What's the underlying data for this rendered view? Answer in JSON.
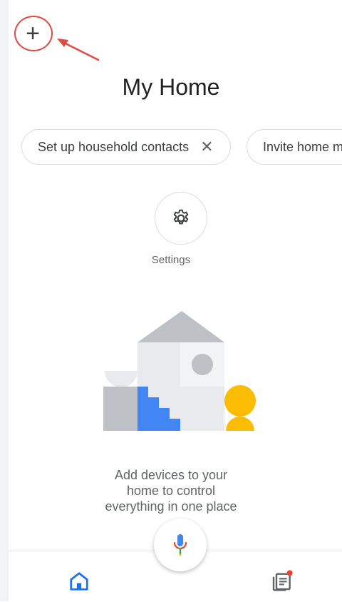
{
  "header": {
    "title": "My Home"
  },
  "chips": [
    {
      "label": "Set up household contacts",
      "close_icon": "close-icon"
    },
    {
      "label": "Invite home m"
    }
  ],
  "settings": {
    "label": "Settings",
    "icon": "gear-icon"
  },
  "empty_state": {
    "line1": "Add devices to your",
    "line2": "home to control",
    "line3": "everything in one place"
  },
  "colors": {
    "accent_blue": "#4285f4",
    "yellow": "#fbbc04",
    "red_annotation": "#e04a3f",
    "gray_light": "#e8eaed",
    "gray_mid": "#bdc1c6",
    "gray_dark": "#9aa0a6"
  },
  "nav": {
    "home_icon": "home-icon",
    "feed_icon": "feed-icon"
  }
}
